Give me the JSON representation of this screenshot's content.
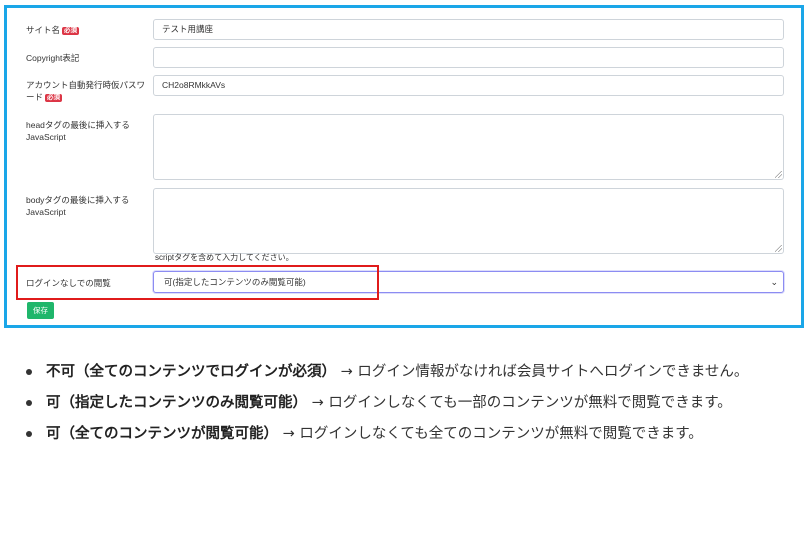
{
  "form": {
    "site_name": {
      "label": "サイト名",
      "badge": "必須",
      "value": "テスト用講座"
    },
    "copyright": {
      "label": "Copyright表記",
      "value": ""
    },
    "password": {
      "label": "アカウント自動発行時仮パスワード",
      "badge": "必須",
      "value": "CH2o8RMkkAVs"
    },
    "head_js": {
      "label": "headタグの最後に挿入するJavaScript"
    },
    "body_js": {
      "label": "bodyタグの最後に挿入するJavaScript",
      "help": "scriptタグを含めて入力してください。"
    },
    "view_without_login": {
      "label": "ログインなしでの閲覧",
      "value": "可(指定したコンテンツのみ閲覧可能)"
    },
    "save_label": "保存"
  },
  "bullets": [
    {
      "bold": "不可（全てのコンテンツでログインが必須）",
      "text": "→ ログイン情報がなければ会員サイトへログインできません。"
    },
    {
      "bold": "可（指定したコンテンツのみ閲覧可能）",
      "text": "→ ログインしなくても一部のコンテンツが無料で閲覧できます。"
    },
    {
      "bold": "可（全てのコンテンツが閲覧可能）",
      "text": "→ ログインしなくても全てのコンテンツが無料で閲覧できます。"
    }
  ],
  "colors": {
    "panel_border": "#1aa6e8",
    "highlight": "#e01b1b",
    "save": "#1fb66b",
    "badge": "#dc3545"
  }
}
